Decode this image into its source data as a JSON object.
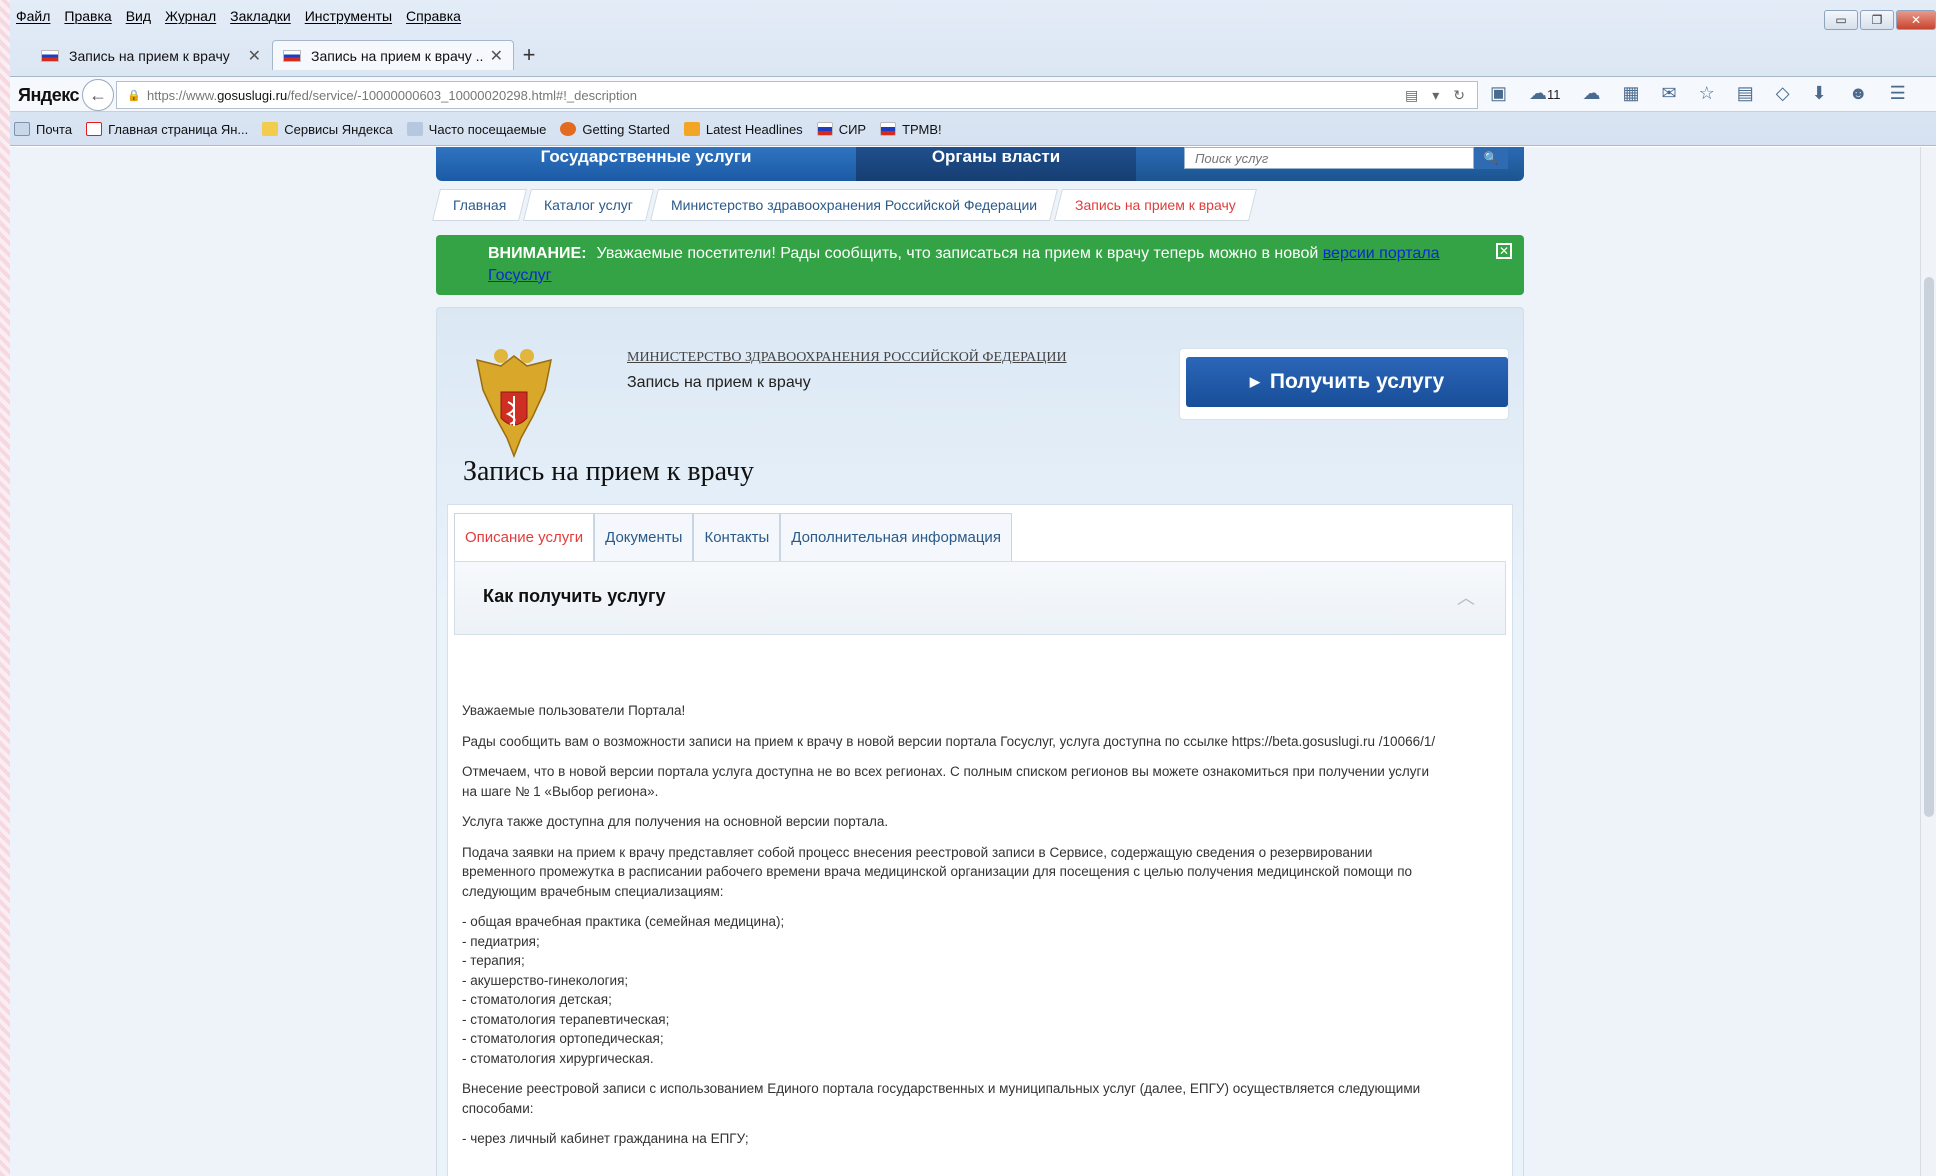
{
  "menu": [
    "Файл",
    "Правка",
    "Вид",
    "Журнал",
    "Закладки",
    "Инструменты",
    "Справка"
  ],
  "tabs": [
    {
      "label": "Запись на прием к врачу"
    },
    {
      "label": "Запись на прием к врачу ..."
    }
  ],
  "browser": {
    "logo": "Яндекс",
    "url_prefix": "https://www.",
    "url_domain": "gosuslugi.ru",
    "url_rest": "/fed/service/-10000000603_10000020298.html#!_description",
    "weather": "11"
  },
  "bookmarks": [
    "Почта",
    "Главная страница Ян...",
    "Сервисы Яндекса",
    "Часто посещаемые",
    "Getting Started",
    "Latest Headlines",
    "СИР",
    "ТРМВ!"
  ],
  "site_nav": {
    "services": "Государственные услуги",
    "authorities": "Органы власти",
    "search_placeholder": "Поиск услуг"
  },
  "breadcrumbs": [
    "Главная",
    "Каталог услуг",
    "Министерство здравоохранения Российской Федерации",
    "Запись на прием к врачу"
  ],
  "alert": {
    "label": "ВНИМАНИЕ:",
    "text": "Уважаемые посетители! Рады сообщить, что записаться на прием к врачу теперь можно в новой ",
    "link1": "версии портала",
    "link2": "Госуслуг",
    "close": "✕"
  },
  "service": {
    "ministry": "МИНИСТЕРСТВО ЗДРАВООХРАНЕНИЯ РОССИЙСКОЙ ФЕДЕРАЦИИ",
    "name": "Запись на прием к врачу",
    "button": "Получить услугу",
    "title": "Запись на прием к врачу"
  },
  "panel_tabs": [
    "Описание услуги",
    "Документы",
    "Контакты",
    "Дополнительная информация"
  ],
  "accordion_title": "Как получить услугу",
  "content": {
    "p1": "Уважаемые пользователи Портала!",
    "p2": "Рады сообщить вам о возможности записи на прием к врачу в новой версии портала Госуслуг, услуга доступна по ссылке https://beta.gosuslugi.ru /10066/1/",
    "p3": "Отмечаем, что в новой версии портала услуга доступна не во всех регионах. С полным списком регионов вы можете ознакомиться при получении услуги на шаге № 1 «Выбор региона».",
    "p4": "Услуга также доступна для получения на основной версии портала.",
    "p5": "Подача заявки на прием к врачу представляет собой процесс внесения реестровой записи в Сервисе, содержащую сведения о резервировании временного промежутка в расписании рабочего времени врача медицинской организации для посещения с целью получения медицинской помощи по следующим врачебным специализациям:",
    "specs": [
      "- общая врачебная практика (семейная медицина);",
      "- педиатрия;",
      "- терапия;",
      "- акушерство-гинекология;",
      "- стоматология детская;",
      "- стоматология терапевтическая;",
      "- стоматология ортопедическая;",
      "- стоматология хирургическая."
    ],
    "p6": "Внесение реестровой записи с использованием Единого портала государственных и муниципальных услуг (далее, ЕПГУ) осуществляется следующими способами:",
    "p7": "- через личный кабинет гражданина на ЕПГУ;"
  }
}
